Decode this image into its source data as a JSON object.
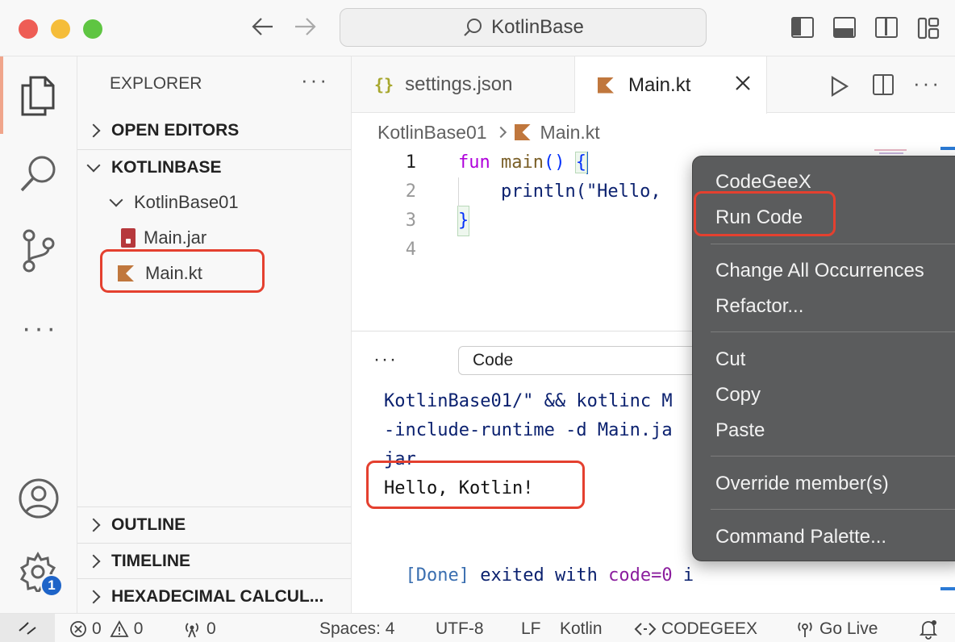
{
  "window": {
    "search_text": "KotlinBase"
  },
  "explorer": {
    "title": "EXPLORER",
    "open_editors": "OPEN EDITORS",
    "project": "KOTLINBASE",
    "folder": "KotlinBase01",
    "files": [
      "Main.jar",
      "Main.kt"
    ],
    "outline": "OUTLINE",
    "timeline": "TIMELINE",
    "hexcalc": "HEXADECIMAL CALCUL..."
  },
  "tabs": [
    {
      "label": "settings.json",
      "icon": "json-braces-icon"
    },
    {
      "label": "Main.kt",
      "icon": "kotlin-icon",
      "active": true
    }
  ],
  "breadcrumb": {
    "folder": "KotlinBase01",
    "file": "Main.kt"
  },
  "editor": {
    "line_numbers": [
      "1",
      "2",
      "3",
      "4"
    ],
    "lines": [
      {
        "kw": "fun",
        "fn": "main",
        "rest": "() ",
        "brace": "{"
      },
      {
        "code": "    println(\"Hello, "
      },
      {
        "brace": "}"
      },
      {
        "code": ""
      }
    ]
  },
  "panel": {
    "select_value": "Code",
    "output": [
      "KotlinBase01/\" && kotlinc M",
      "-include-runtime -d Main.ja",
      "jar",
      "Hello, Kotlin!",
      "",
      "[Done] exited with code=0 i"
    ]
  },
  "context_menu": {
    "groups": [
      [
        "CodeGeeX",
        "Run Code"
      ],
      [
        "Change All Occurrences",
        "Refactor..."
      ],
      [
        "Cut",
        "Copy",
        "Paste"
      ],
      [
        "Override member(s)"
      ],
      [
        "Command Palette..."
      ]
    ]
  },
  "status": {
    "errors": "0",
    "warnings": "0",
    "ports": "0",
    "spaces": "Spaces: 4",
    "encoding": "UTF-8",
    "eol": "LF",
    "language": "Kotlin",
    "codegeex": "CODEGEEX",
    "golive": "Go Live",
    "badge": "1"
  },
  "colors": {
    "highlight": "#e4402f",
    "menu_bg": "#5b5c5d",
    "kotlin_brown": "#c0773d"
  }
}
